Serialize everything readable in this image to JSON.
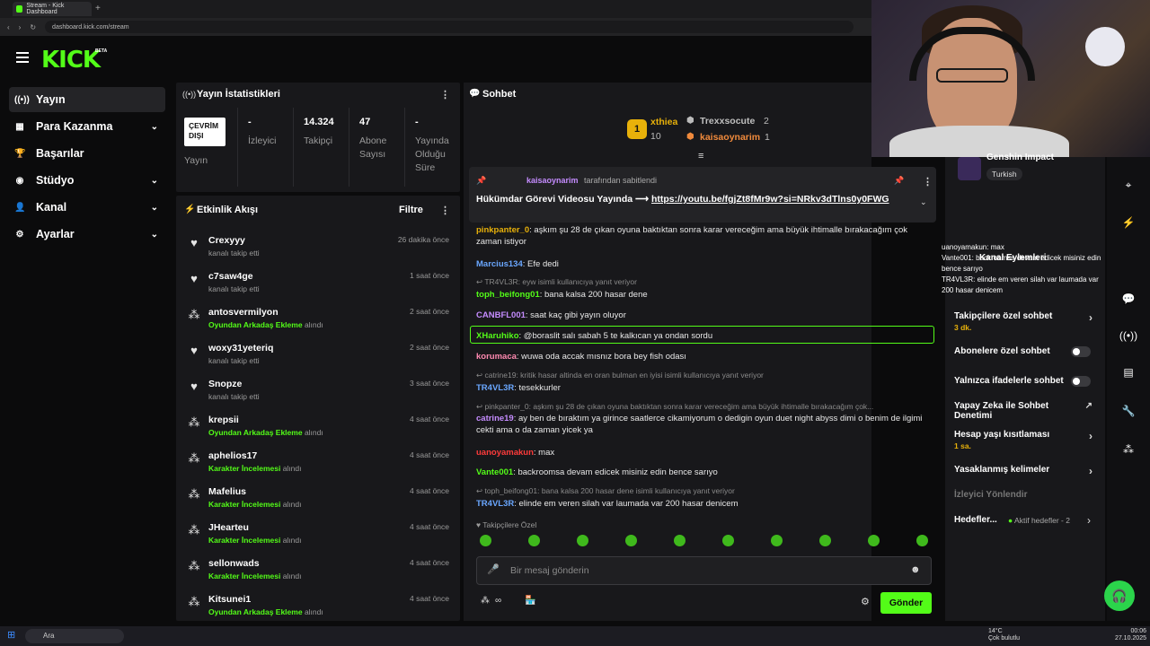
{
  "browser": {
    "tab_title": "Stream - Kick Dashboard",
    "new_tab": "+",
    "url": "dashboard.kick.com/stream"
  },
  "header": {
    "logo": "KICK",
    "beta": "BETA"
  },
  "sidebar": {
    "items": [
      {
        "label": "Yayın",
        "icon": "broadcast-icon",
        "glyph": "((•))",
        "active": true,
        "expandable": false
      },
      {
        "label": "Para Kazanma",
        "icon": "monetization-icon",
        "glyph": "▦",
        "active": false,
        "expandable": true
      },
      {
        "label": "Başarılar",
        "icon": "trophy-icon",
        "glyph": "🏆",
        "active": false,
        "expandable": false
      },
      {
        "label": "Stüdyo",
        "icon": "studio-icon",
        "glyph": "◉",
        "active": false,
        "expandable": true
      },
      {
        "label": "Kanal",
        "icon": "channel-icon",
        "glyph": "👤",
        "active": false,
        "expandable": true
      },
      {
        "label": "Ayarlar",
        "icon": "settings-icon",
        "glyph": "⚙",
        "active": false,
        "expandable": true
      }
    ]
  },
  "stats": {
    "title": "Yayın İstatistikleri",
    "offline_label": "ÇEVRİM DIŞI",
    "offline_caption": "Yayın",
    "items": [
      {
        "value": "-",
        "label": "İzleyici"
      },
      {
        "value": "14.324",
        "label": "Takipçi"
      },
      {
        "value": "47",
        "label": "Abone Sayısı"
      },
      {
        "value": "-",
        "label": "Yayında Olduğu Süre"
      }
    ]
  },
  "activity": {
    "title": "Etkinlik Akışı",
    "filter": "Filtre",
    "rows": [
      {
        "name": "Crexyyy",
        "sub": "kanalı takip etti",
        "highlight": "",
        "time": "26 dakika önce",
        "icon": "heart"
      },
      {
        "name": "c7saw4ge",
        "sub": "kanalı takip etti",
        "highlight": "",
        "time": "1 saat önce",
        "icon": "heart"
      },
      {
        "name": "antosvermilyon",
        "sub": "alındı",
        "highlight": "Oyundan Arkadaş Ekleme",
        "time": "2 saat önce",
        "icon": "reward"
      },
      {
        "name": "woxy31yeteriq",
        "sub": "kanalı takip etti",
        "highlight": "",
        "time": "2 saat önce",
        "icon": "heart"
      },
      {
        "name": "Snopze",
        "sub": "kanalı takip etti",
        "highlight": "",
        "time": "3 saat önce",
        "icon": "heart"
      },
      {
        "name": "krepsii",
        "sub": "alındı",
        "highlight": "Oyundan Arkadaş Ekleme",
        "time": "4 saat önce",
        "icon": "reward"
      },
      {
        "name": "aphelios17",
        "sub": "alındı",
        "highlight": "Karakter İncelemesi",
        "time": "4 saat önce",
        "icon": "reward"
      },
      {
        "name": "Mafelius",
        "sub": "alındı",
        "highlight": "Karakter İncelemesi",
        "time": "4 saat önce",
        "icon": "reward"
      },
      {
        "name": "JHearteu",
        "sub": "alındı",
        "highlight": "Karakter İncelemesi",
        "time": "4 saat önce",
        "icon": "reward"
      },
      {
        "name": "sellonwads",
        "sub": "alındı",
        "highlight": "Karakter İncelemesi",
        "time": "4 saat önce",
        "icon": "reward"
      },
      {
        "name": "Kitsunei1",
        "sub": "alındı",
        "highlight": "Oyundan Arkadaş Ekleme",
        "time": "4 saat önce",
        "icon": "reward"
      }
    ]
  },
  "chat": {
    "title": "Sohbet",
    "leaders": [
      {
        "rank": "1",
        "name": "xthiea",
        "amount": "10",
        "color": "#e8b10a"
      },
      {
        "name": "Trexxsocute",
        "amount": "2",
        "color": "#bfbfbf"
      },
      {
        "name": "kaisaoynarim",
        "amount": "1",
        "color": "#f08a3c"
      }
    ],
    "pinned": {
      "by_user": "kaisaoynarim",
      "by_suffix": "tarafından sabitlendi",
      "text": "Hükümdar Görevi Videosu Yayında ⟶ ",
      "link": "https://youtu.be/fgjZt8fMr9w?si=NRkv3dTlns0y0FWG"
    },
    "messages": [
      {
        "user": "pinkpanter_0",
        "color": "#e8b10a",
        "text": ": aşkım şu 28 de çıkan oyuna baktıktan sonra karar vereceğim ama büyük ihtimalle bırakacağım çok zaman istiyor"
      },
      {
        "user": "Marcius134",
        "color": "#6aa7ff",
        "text": ": Efe dedi"
      },
      {
        "reply": "TR4VL3R: eyw isimli kullanıcıya yanıt veriyor"
      },
      {
        "user": "toph_beifong01",
        "color": "#53fc18",
        "text": ": bana kalsa 200 hasar dene"
      },
      {
        "user": "CANBFL001",
        "color": "#c58cff",
        "text": ": saat kaç gibi yayın oluyor"
      },
      {
        "user": "XHaruhiko",
        "color": "#53fc18",
        "text": ": @boraslit salı sabah 5 te kalkıcan ya ondan sordu",
        "highlight": true
      },
      {
        "user": "korumaca",
        "color": "#ff8ab1",
        "text": ": wuwa oda accak mısnız bora bey fish odası"
      },
      {
        "reply": "catrine19: kritik hasar altinda en oran bulman en iyisi isimli kullanıcıya yanıt veriyor"
      },
      {
        "user": "TR4VL3R",
        "color": "#6aa7ff",
        "text": ": tesekkurler"
      },
      {
        "reply": "pinkpanter_0: aşkım şu 28 de çıkan oyuna baktıktan sonra karar vereceğim ama büyük ihtimalle bırakacağım çok..."
      },
      {
        "user": "catrine19",
        "color": "#c58cff",
        "text": ": ay ben de bıraktım ya girince saatlerce cikamiyorum o dedigin oyun duet night abyss dimi o benim de ilgimi cekti ama o da zaman yicek ya"
      },
      {
        "user": "uanoyamakun",
        "color": "#ff3b3b",
        "text": ": max"
      },
      {
        "user": "Vante001",
        "color": "#53fc18",
        "text": ": backroomsa devam edicek misiniz edin bence sarıyo"
      },
      {
        "reply": "toph_beifong01: bana kalsa 200 hasar dene isimli kullanıcıya yanıt veriyor"
      },
      {
        "user": "TR4VL3R",
        "color": "#6aa7ff",
        "text": ": elinde em veren silah var laumada var 200 hasar denicem"
      }
    ],
    "mode_label": "Takipçilere Özel",
    "input_placeholder": "Bir mesaj gönderin",
    "send_label": "Gönder",
    "infinite": "∞"
  },
  "side_overlay": {
    "game": "Genshin Impact",
    "language": "Turkish",
    "overlay_lines": [
      "uanoyamakun: max",
      "Vante001: backroomsa devam edicek misiniz edin bence sarıyo",
      "TR4VL3R: elinde em veren silah var laumada var 200 hasar denicem"
    ]
  },
  "channel_settings": {
    "title": "Kanal Eylemleri",
    "rows": [
      {
        "label": "Takipçilere özel sohbet",
        "sub": "3 dk.",
        "control": "chevron"
      },
      {
        "label": "Abonelere özel sohbet",
        "sub": "",
        "control": "toggle"
      },
      {
        "label": "Yalnızca ifadelerle sohbet",
        "sub": "",
        "control": "toggle"
      },
      {
        "label": "Yapay Zeka ile Sohbet Denetimi",
        "sub": "",
        "control": "external"
      },
      {
        "label": "Hesap yaşı kısıtlaması",
        "sub": "1 sa.",
        "control": "chevron"
      },
      {
        "label": "Yasaklanmış kelimeler",
        "sub": "",
        "control": "chevron"
      }
    ],
    "section": "İzleyici Yönlendir",
    "goals_label": "Hedefler...",
    "goals_status": "Aktif hedefler - 2"
  },
  "taskbar": {
    "search": "Ara",
    "weather_temp": "14°C",
    "weather_desc": "Çok bulutlu",
    "time": "00:06",
    "date": "27.10.2025"
  },
  "colors": {
    "accent": "#53fc18",
    "panel": "#18181b",
    "background": "#0b0b0c"
  }
}
